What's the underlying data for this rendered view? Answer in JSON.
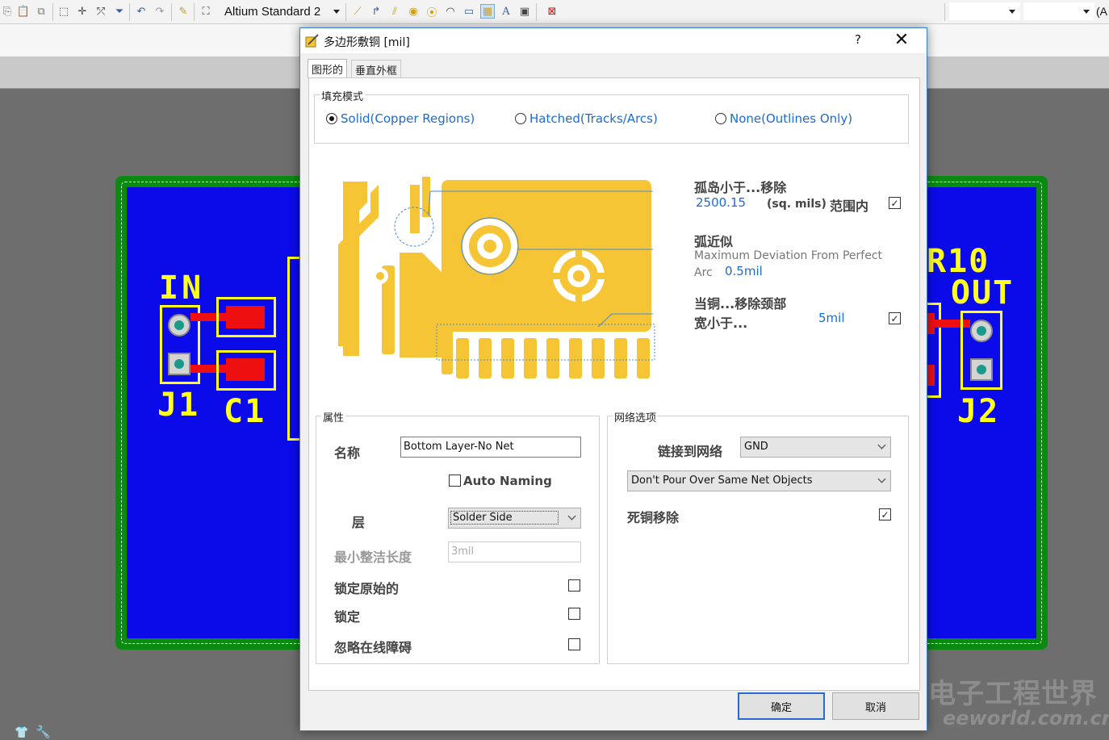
{
  "toolbar": {
    "standard_select": "Altium Standard 2",
    "trailing_text": "(A"
  },
  "pcb": {
    "labels": {
      "in": "IN",
      "j1": "J1",
      "c1": "C1",
      "r10": "R10",
      "out": "OUT",
      "j2": "J2"
    }
  },
  "dialog": {
    "title": "多边形敷铜 [mil]",
    "help": "?",
    "close": "✕",
    "tabs": [
      "图形的",
      "垂直外框"
    ],
    "fill_mode": {
      "label": "填充模式",
      "options": [
        "Solid(Copper Regions)",
        "Hatched(Tracks/Arcs)",
        "None(Outlines Only)"
      ],
      "selected": 0
    },
    "diagram": {
      "island_label": "孤岛小于...移除",
      "island_value": "2500.15",
      "island_unit": "(sq. mils)",
      "island_range": "范围内",
      "arc_label": "弧近似",
      "arc_desc_1": "Maximum Deviation From Perfect",
      "arc_desc_2": "Arc",
      "arc_value": "0.5mil",
      "neck_label_1": "当铜...移除颈部",
      "neck_label_2": "宽小于...",
      "neck_value": "5mil"
    },
    "properties": {
      "label": "属性",
      "name_label": "名称",
      "name_value": "Bottom Layer-No Net",
      "auto_naming": "Auto Naming",
      "layer_label": "层",
      "layer_value": "Solder Side",
      "min_prim_label": "最小整洁长度",
      "min_prim_value": "3mil",
      "lock_primitives": "锁定原始的",
      "locked": "锁定",
      "ignore_drc": "忽略在线障碍"
    },
    "net_options": {
      "label": "网络选项",
      "connect_label": "链接到网络",
      "connect_value": "GND",
      "pour_value": "Don't Pour Over Same Net Objects",
      "remove_dead": "死铜移除"
    },
    "buttons": {
      "ok": "确定",
      "cancel": "取消"
    }
  },
  "watermark": {
    "text": "电子工程世界",
    "sub": "eeworld.com.cn"
  },
  "colors": {
    "pcb_blue": "#0b0bea",
    "pcb_green": "#0a8a10",
    "silk_yellow": "#ffff20",
    "copper_gold": "#f5c535",
    "accent_blue": "#1e6bd0"
  }
}
